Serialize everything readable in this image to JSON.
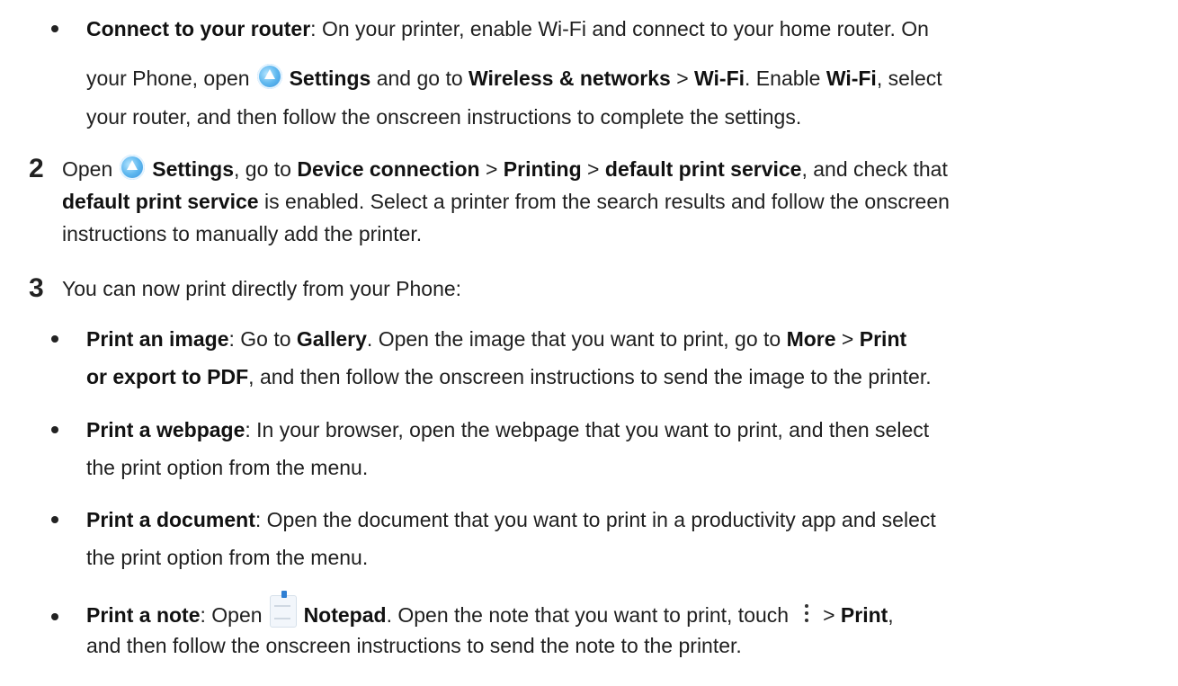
{
  "steps": [
    {
      "number": "2"
    },
    {
      "number": "3"
    }
  ],
  "content": {
    "p1": {
      "b1": "Connect to your router",
      "t1": ": On your printer, enable Wi-Fi and connect to your home router. On",
      "t2": "your Phone, open",
      "b2": "Settings",
      "t3": " and go to ",
      "b3": "Wireless & networks",
      "t4": " > ",
      "b4": "Wi-Fi",
      "t5": ". Enable ",
      "b5": "Wi-Fi",
      "t6": ", select",
      "t7": "your router, and then follow the onscreen instructions to complete the settings."
    },
    "p2": {
      "t1": "Open",
      "b1": "Settings",
      "t2": ", go to ",
      "b2": "Device connection",
      "t3": " > ",
      "b3": "Printing",
      "t4": " > ",
      "b4": "default print service",
      "t5": ", and check that",
      "b5": "default print service",
      "t6": " is enabled. Select a printer from the search results and follow the onscreen",
      "t7": "instructions to manually add the printer."
    },
    "p3": {
      "t1": "You can now print directly from your Phone:"
    },
    "p4": {
      "b1": "Print an image",
      "t1": ": Go to ",
      "b2": "Gallery",
      "t2": ". Open the image that you want to print, go to ",
      "b3": "More",
      "t3": " > ",
      "b4": "Print",
      "b5": "or export to PDF",
      "t4": ", and then follow the onscreen instructions to send the image to the printer."
    },
    "p5": {
      "b1": "Print a webpage",
      "t1": ": In your browser, open the webpage that you want to print, and then select",
      "t2": "the print option from the menu."
    },
    "p6": {
      "b1": "Print a document",
      "t1": ": Open the document that you want to print in a productivity app and select",
      "t2": "the print option from the menu."
    },
    "p7": {
      "b1": "Print a note",
      "t1": ": Open",
      "b2": "Notepad",
      "t2": ". Open the note that you want to print, touch",
      "t3": "> ",
      "b3": "Print",
      "t4": ",",
      "t5": "and then follow the onscreen instructions to send the note to the printer."
    }
  },
  "icons": {
    "settings": "settings-icon",
    "notepad": "notepad-icon",
    "more": "more-vertical-icon"
  }
}
